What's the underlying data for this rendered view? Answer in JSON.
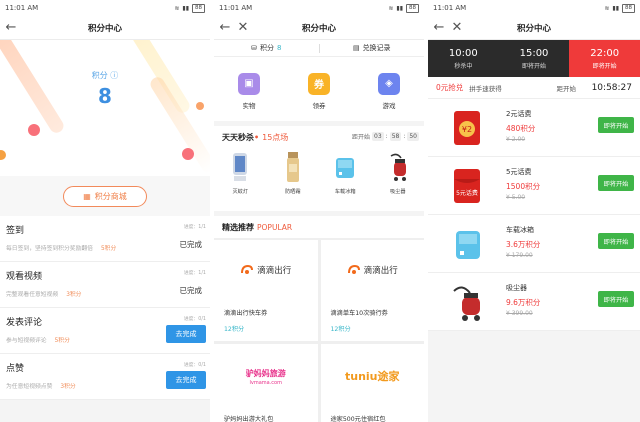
{
  "status": {
    "time": "11:01 AM",
    "battery": "88"
  },
  "screen1": {
    "title": "积分中心",
    "points_label": "积分",
    "points_value": "8",
    "mall_button": "积分商城",
    "tasks": [
      {
        "name": "签到",
        "desc": "每日签到，坚持签到积分奖励翻倍",
        "reward": "5积分",
        "progress": "进度：1/1",
        "state": "已完成"
      },
      {
        "name": "观看视频",
        "desc": "完整观看任意短视频",
        "reward": "3积分",
        "progress": "进度：1/1",
        "state": "已完成"
      },
      {
        "name": "发表评论",
        "desc": "参与短视频评论",
        "reward": "5积分",
        "progress": "进度：0/1",
        "button": "去完成"
      },
      {
        "name": "点赞",
        "desc": "为任意短视频点赞",
        "reward": "3积分",
        "progress": "进度：0/1",
        "button": "去完成"
      }
    ]
  },
  "screen2": {
    "title": "积分中心",
    "points_label": "积分",
    "points_value": "8",
    "exchange_label": "兑换记录",
    "categories": [
      {
        "label": "实物",
        "icon": "bag-icon",
        "color": "#a98be9"
      },
      {
        "label": "领券",
        "icon": "coupon-icon",
        "color": "#f9b327",
        "glyph": "券"
      },
      {
        "label": "游戏",
        "icon": "gamepad-icon",
        "color": "#6d84ef"
      }
    ],
    "flash": {
      "title": "天天秒杀",
      "subtitle": "15点场",
      "countdown_label": "距开始",
      "h": "03",
      "m": "58",
      "s": "50"
    },
    "flash_items": [
      {
        "label": "灭蚊灯",
        "icon": "mosquito-lamp-icon"
      },
      {
        "label": "防晒霜",
        "icon": "sunscreen-icon"
      },
      {
        "label": "车载冰箱",
        "icon": "car-fridge-icon"
      },
      {
        "label": "吸尘器",
        "icon": "vacuum-icon"
      }
    ],
    "recommend": {
      "title": "精选推荐",
      "subtitle": "POPULAR"
    },
    "grid": [
      {
        "brand": "滴滴出行",
        "name": "滴滴出行快车券",
        "pts": "12积分"
      },
      {
        "brand": "滴滴出行",
        "name": "滴滴单车10次骑行券",
        "pts": "12积分"
      },
      {
        "brand": "驴妈妈旅游",
        "name": "驴妈妈出游大礼包",
        "brand_sub": "lvmama.com"
      },
      {
        "brand": "tuniu途家",
        "name": "途家500元住宿红包"
      }
    ]
  },
  "screen3": {
    "title": "积分中心",
    "tabs": [
      {
        "time": "10:00",
        "sub": "秒杀中"
      },
      {
        "time": "15:00",
        "sub": "即将开始"
      },
      {
        "time": "22:00",
        "sub": "即将开始"
      }
    ],
    "grab_title": "0元抢兑",
    "grab_sub": "拼手速获得",
    "countdown_label": "距开始",
    "countdown": "10:58:27",
    "products": [
      {
        "name": "2元话费",
        "cost": "480积分",
        "orig": "¥ 2.00",
        "button": "即将开始",
        "icon": "hongbao-icon",
        "badge": "¥2"
      },
      {
        "name": "5元话费",
        "cost": "1500积分",
        "orig": "¥ 5.00",
        "button": "即将开始",
        "icon": "hongbao-icon",
        "badge": "5元话费"
      },
      {
        "name": "车载冰箱",
        "cost": "3.6万积分",
        "orig": "¥ 179.00",
        "button": "即将开始",
        "icon": "car-fridge-icon"
      },
      {
        "name": "吸尘器",
        "cost": "9.6万积分",
        "orig": "¥ 399.00",
        "button": "即将开始",
        "icon": "vacuum-icon"
      }
    ]
  }
}
